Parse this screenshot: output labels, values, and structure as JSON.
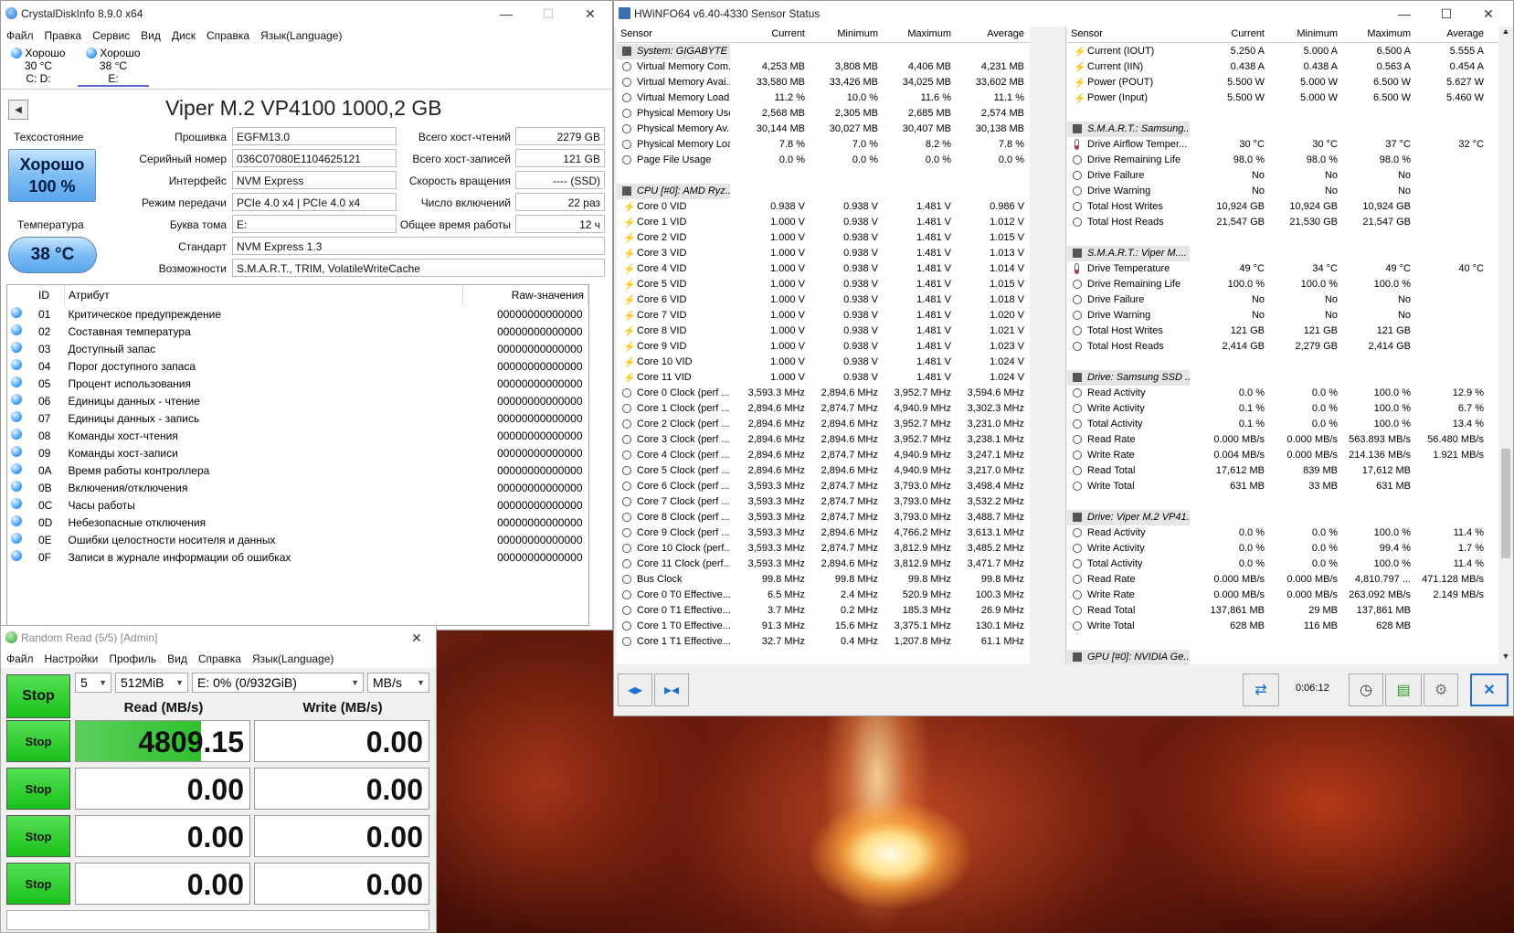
{
  "cdi": {
    "title": "CrystalDiskInfo 8.9.0 x64",
    "menu": [
      "Файл",
      "Правка",
      "Сервис",
      "Вид",
      "Диск",
      "Справка",
      "Язык(Language)"
    ],
    "drives": [
      {
        "status": "Хорошо",
        "temp": "30 °C",
        "letters": "C: D:"
      },
      {
        "status": "Хорошо",
        "temp": "38 °C",
        "letters": "E:"
      }
    ],
    "model": "Viper M.2 VP4100 1000,2 GB",
    "health_label": "Техсостояние",
    "health_status": "Хорошо",
    "health_pct": "100 %",
    "temp_label": "Температура",
    "temp_value": "38 °C",
    "fields": {
      "firmware_label": "Прошивка",
      "firmware": "EGFM13.0",
      "serial_label": "Серийный номер",
      "serial": "036C07080E1104625121",
      "interface_label": "Интерфейс",
      "interface": "NVM Express",
      "transfer_label": "Режим передачи",
      "transfer": "PCIe 4.0 x4 | PCIe 4.0 x4",
      "letter_label": "Буква тома",
      "letter": "E:",
      "standard_label": "Стандарт",
      "standard": "NVM Express 1.3",
      "features_label": "Возможности",
      "features": "S.M.A.R.T., TRIM, VolatileWriteCache",
      "reads_label": "Всего хост-чтений",
      "reads": "2279 GB",
      "writes_label": "Всего хост-записей",
      "writes": "121 GB",
      "rpm_label": "Скорость вращения",
      "rpm": "---- (SSD)",
      "power_count_label": "Число включений",
      "power_count": "22 раз",
      "power_hours_label": "Общее время работы",
      "power_hours": "12 ч"
    },
    "attr_headers": {
      "id": "ID",
      "name": "Атрибут",
      "raw": "Raw-значения"
    },
    "attributes": [
      {
        "id": "01",
        "name": "Критическое предупреждение",
        "raw": "00000000000000"
      },
      {
        "id": "02",
        "name": "Составная температура",
        "raw": "00000000000000"
      },
      {
        "id": "03",
        "name": "Доступный запас",
        "raw": "00000000000000"
      },
      {
        "id": "04",
        "name": "Порог доступного запаса",
        "raw": "00000000000000"
      },
      {
        "id": "05",
        "name": "Процент использования",
        "raw": "00000000000000"
      },
      {
        "id": "06",
        "name": "Единицы данных - чтение",
        "raw": "00000000000000"
      },
      {
        "id": "07",
        "name": "Единицы данных - запись",
        "raw": "00000000000000"
      },
      {
        "id": "08",
        "name": "Команды хост-чтения",
        "raw": "00000000000000"
      },
      {
        "id": "09",
        "name": "Команды хост-записи",
        "raw": "00000000000000"
      },
      {
        "id": "0A",
        "name": "Время работы контроллера",
        "raw": "00000000000000"
      },
      {
        "id": "0B",
        "name": "Включения/отключения",
        "raw": "00000000000000"
      },
      {
        "id": "0C",
        "name": "Часы работы",
        "raw": "00000000000000"
      },
      {
        "id": "0D",
        "name": "Небезопасные отключения",
        "raw": "00000000000000"
      },
      {
        "id": "0E",
        "name": "Ошибки целостности носителя и данных",
        "raw": "00000000000000"
      },
      {
        "id": "0F",
        "name": "Записи в журнале информации об ошибках",
        "raw": "00000000000000"
      }
    ]
  },
  "cdm": {
    "title": "Random Read (5/5) [Admin]",
    "menu": [
      "Файл",
      "Настройки",
      "Профиль",
      "Вид",
      "Справка",
      "Язык(Language)"
    ],
    "count": "5",
    "size": "512MiB",
    "drive": "E: 0% (0/932GiB)",
    "unit": "MB/s",
    "all_label": "Stop",
    "read_header": "Read (MB/s)",
    "write_header": "Write (MB/s)",
    "rows": [
      {
        "btn": "Stop",
        "read": "4809.15",
        "write": "0.00"
      },
      {
        "btn": "Stop",
        "read": "0.00",
        "write": "0.00"
      },
      {
        "btn": "Stop",
        "read": "0.00",
        "write": "0.00"
      },
      {
        "btn": "Stop",
        "read": "0.00",
        "write": "0.00"
      }
    ],
    "read_progress": 0.72
  },
  "hw": {
    "title": "HWiNFO64 v6.40-4330 Sensor Status",
    "headers": {
      "sensor": "Sensor",
      "current": "Current",
      "minimum": "Minimum",
      "maximum": "Maximum",
      "average": "Average"
    },
    "time": "0:06:12",
    "left": [
      {
        "t": "sec",
        "n": "System: GIGABYTE ..."
      },
      {
        "t": "clock",
        "n": "Virtual Memory Com...",
        "v": [
          "4,253 MB",
          "3,808 MB",
          "4,406 MB",
          "4,231 MB"
        ]
      },
      {
        "t": "clock",
        "n": "Virtual Memory Avai...",
        "v": [
          "33,580 MB",
          "33,426 MB",
          "34,025 MB",
          "33,602 MB"
        ]
      },
      {
        "t": "clock",
        "n": "Virtual Memory Load",
        "v": [
          "11.2 %",
          "10.0 %",
          "11.6 %",
          "11.1 %"
        ]
      },
      {
        "t": "clock",
        "n": "Physical Memory Used",
        "v": [
          "2,568 MB",
          "2,305 MB",
          "2,685 MB",
          "2,574 MB"
        ]
      },
      {
        "t": "clock",
        "n": "Physical Memory Av...",
        "v": [
          "30,144 MB",
          "30,027 MB",
          "30,407 MB",
          "30,138 MB"
        ]
      },
      {
        "t": "clock",
        "n": "Physical Memory Load",
        "v": [
          "7.8 %",
          "7.0 %",
          "8.2 %",
          "7.8 %"
        ]
      },
      {
        "t": "clock",
        "n": "Page File Usage",
        "v": [
          "0.0 %",
          "0.0 %",
          "0.0 %",
          "0.0 %"
        ]
      },
      {
        "t": "blank"
      },
      {
        "t": "sec",
        "n": "CPU [#0]: AMD Ryz..."
      },
      {
        "t": "bolt",
        "n": "Core 0 VID",
        "v": [
          "0.938 V",
          "0.938 V",
          "1.481 V",
          "0.986 V"
        ]
      },
      {
        "t": "bolt",
        "n": "Core 1 VID",
        "v": [
          "1.000 V",
          "0.938 V",
          "1.481 V",
          "1.012 V"
        ]
      },
      {
        "t": "bolt",
        "n": "Core 2 VID",
        "v": [
          "1.000 V",
          "0.938 V",
          "1.481 V",
          "1.015 V"
        ]
      },
      {
        "t": "bolt",
        "n": "Core 3 VID",
        "v": [
          "1.000 V",
          "0.938 V",
          "1.481 V",
          "1.013 V"
        ]
      },
      {
        "t": "bolt",
        "n": "Core 4 VID",
        "v": [
          "1.000 V",
          "0.938 V",
          "1.481 V",
          "1.014 V"
        ]
      },
      {
        "t": "bolt",
        "n": "Core 5 VID",
        "v": [
          "1.000 V",
          "0.938 V",
          "1.481 V",
          "1.015 V"
        ]
      },
      {
        "t": "bolt",
        "n": "Core 6 VID",
        "v": [
          "1.000 V",
          "0.938 V",
          "1.481 V",
          "1.018 V"
        ]
      },
      {
        "t": "bolt",
        "n": "Core 7 VID",
        "v": [
          "1.000 V",
          "0.938 V",
          "1.481 V",
          "1.020 V"
        ]
      },
      {
        "t": "bolt",
        "n": "Core 8 VID",
        "v": [
          "1.000 V",
          "0.938 V",
          "1.481 V",
          "1.021 V"
        ]
      },
      {
        "t": "bolt",
        "n": "Core 9 VID",
        "v": [
          "1.000 V",
          "0.938 V",
          "1.481 V",
          "1.023 V"
        ]
      },
      {
        "t": "bolt",
        "n": "Core 10 VID",
        "v": [
          "1.000 V",
          "0.938 V",
          "1.481 V",
          "1.024 V"
        ]
      },
      {
        "t": "bolt",
        "n": "Core 11 VID",
        "v": [
          "1.000 V",
          "0.938 V",
          "1.481 V",
          "1.024 V"
        ]
      },
      {
        "t": "clock",
        "n": "Core 0 Clock (perf ...",
        "v": [
          "3,593.3 MHz",
          "2,894.6 MHz",
          "3,952.7 MHz",
          "3,594.6 MHz"
        ]
      },
      {
        "t": "clock",
        "n": "Core 1 Clock (perf ...",
        "v": [
          "2,894.6 MHz",
          "2,874.7 MHz",
          "4,940.9 MHz",
          "3,302.3 MHz"
        ]
      },
      {
        "t": "clock",
        "n": "Core 2 Clock (perf ...",
        "v": [
          "2,894.6 MHz",
          "2,894.6 MHz",
          "3,952.7 MHz",
          "3,231.0 MHz"
        ]
      },
      {
        "t": "clock",
        "n": "Core 3 Clock (perf ...",
        "v": [
          "2,894.6 MHz",
          "2,894.6 MHz",
          "3,952.7 MHz",
          "3,238.1 MHz"
        ]
      },
      {
        "t": "clock",
        "n": "Core 4 Clock (perf ...",
        "v": [
          "2,894.6 MHz",
          "2,874.7 MHz",
          "4,940.9 MHz",
          "3,247.1 MHz"
        ]
      },
      {
        "t": "clock",
        "n": "Core 5 Clock (perf ...",
        "v": [
          "2,894.6 MHz",
          "2,894.6 MHz",
          "4,940.9 MHz",
          "3,217.0 MHz"
        ]
      },
      {
        "t": "clock",
        "n": "Core 6 Clock (perf ...",
        "v": [
          "3,593.3 MHz",
          "2,874.7 MHz",
          "3,793.0 MHz",
          "3,498.4 MHz"
        ]
      },
      {
        "t": "clock",
        "n": "Core 7 Clock (perf ...",
        "v": [
          "3,593.3 MHz",
          "2,874.7 MHz",
          "3,793.0 MHz",
          "3,532.2 MHz"
        ]
      },
      {
        "t": "clock",
        "n": "Core 8 Clock (perf ...",
        "v": [
          "3,593.3 MHz",
          "2,874.7 MHz",
          "3,793.0 MHz",
          "3,488.7 MHz"
        ]
      },
      {
        "t": "clock",
        "n": "Core 9 Clock (perf ...",
        "v": [
          "3,593.3 MHz",
          "2,894.6 MHz",
          "4,766.2 MHz",
          "3,613.1 MHz"
        ]
      },
      {
        "t": "clock",
        "n": "Core 10 Clock (perf...",
        "v": [
          "3,593.3 MHz",
          "2,874.7 MHz",
          "3,812.9 MHz",
          "3,485.2 MHz"
        ]
      },
      {
        "t": "clock",
        "n": "Core 11 Clock (perf...",
        "v": [
          "3,593.3 MHz",
          "2,894.6 MHz",
          "3,812.9 MHz",
          "3,471.7 MHz"
        ]
      },
      {
        "t": "clock",
        "n": "Bus Clock",
        "v": [
          "99.8 MHz",
          "99.8 MHz",
          "99.8 MHz",
          "99.8 MHz"
        ]
      },
      {
        "t": "clock",
        "n": "Core 0 T0 Effective...",
        "v": [
          "6.5 MHz",
          "2.4 MHz",
          "520.9 MHz",
          "100.3 MHz"
        ]
      },
      {
        "t": "clock",
        "n": "Core 0 T1 Effective...",
        "v": [
          "3.7 MHz",
          "0.2 MHz",
          "185.3 MHz",
          "26.9 MHz"
        ]
      },
      {
        "t": "clock",
        "n": "Core 1 T0 Effective...",
        "v": [
          "91.3 MHz",
          "15.6 MHz",
          "3,375.1 MHz",
          "130.1 MHz"
        ]
      },
      {
        "t": "clock",
        "n": "Core 1 T1 Effective...",
        "v": [
          "32.7 MHz",
          "0.4 MHz",
          "1,207.8 MHz",
          "61.1 MHz"
        ]
      }
    ],
    "right": [
      {
        "t": "bolt",
        "n": "Current (IOUT)",
        "v": [
          "5.250 A",
          "5.000 A",
          "6.500 A",
          "5.555 A"
        ]
      },
      {
        "t": "bolt",
        "n": "Current (IIN)",
        "v": [
          "0.438 A",
          "0.438 A",
          "0.563 A",
          "0.454 A"
        ]
      },
      {
        "t": "bolt",
        "n": "Power (POUT)",
        "v": [
          "5.500 W",
          "5.000 W",
          "6.500 W",
          "5.627 W"
        ]
      },
      {
        "t": "bolt",
        "n": "Power (Input)",
        "v": [
          "5.500 W",
          "5.000 W",
          "6.500 W",
          "5.460 W"
        ]
      },
      {
        "t": "blank"
      },
      {
        "t": "sec",
        "n": "S.M.A.R.T.: Samsung..."
      },
      {
        "t": "therm",
        "n": "Drive Airflow Temper...",
        "v": [
          "30 °C",
          "30 °C",
          "37 °C",
          "32 °C"
        ]
      },
      {
        "t": "clock",
        "n": "Drive Remaining Life",
        "v": [
          "98.0 %",
          "98.0 %",
          "98.0 %",
          ""
        ]
      },
      {
        "t": "clock",
        "n": "Drive Failure",
        "v": [
          "No",
          "No",
          "No",
          ""
        ]
      },
      {
        "t": "clock",
        "n": "Drive Warning",
        "v": [
          "No",
          "No",
          "No",
          ""
        ]
      },
      {
        "t": "clock",
        "n": "Total Host Writes",
        "v": [
          "10,924 GB",
          "10,924 GB",
          "10,924 GB",
          ""
        ]
      },
      {
        "t": "clock",
        "n": "Total Host Reads",
        "v": [
          "21,547 GB",
          "21,530 GB",
          "21,547 GB",
          ""
        ]
      },
      {
        "t": "blank"
      },
      {
        "t": "sec",
        "n": "S.M.A.R.T.: Viper M...."
      },
      {
        "t": "therm",
        "n": "Drive Temperature",
        "v": [
          "49 °C",
          "34 °C",
          "49 °C",
          "40 °C"
        ]
      },
      {
        "t": "clock",
        "n": "Drive Remaining Life",
        "v": [
          "100.0 %",
          "100.0 %",
          "100.0 %",
          ""
        ]
      },
      {
        "t": "clock",
        "n": "Drive Failure",
        "v": [
          "No",
          "No",
          "No",
          ""
        ]
      },
      {
        "t": "clock",
        "n": "Drive Warning",
        "v": [
          "No",
          "No",
          "No",
          ""
        ]
      },
      {
        "t": "clock",
        "n": "Total Host Writes",
        "v": [
          "121 GB",
          "121 GB",
          "121 GB",
          ""
        ]
      },
      {
        "t": "clock",
        "n": "Total Host Reads",
        "v": [
          "2,414 GB",
          "2,279 GB",
          "2,414 GB",
          ""
        ]
      },
      {
        "t": "blank"
      },
      {
        "t": "sec",
        "n": "Drive: Samsung SSD ..."
      },
      {
        "t": "clock",
        "n": "Read Activity",
        "v": [
          "0.0 %",
          "0.0 %",
          "100.0 %",
          "12.9 %"
        ]
      },
      {
        "t": "clock",
        "n": "Write Activity",
        "v": [
          "0.1 %",
          "0.0 %",
          "100.0 %",
          "6.7 %"
        ]
      },
      {
        "t": "clock",
        "n": "Total Activity",
        "v": [
          "0.1 %",
          "0.0 %",
          "100.0 %",
          "13.4 %"
        ]
      },
      {
        "t": "clock",
        "n": "Read Rate",
        "v": [
          "0.000 MB/s",
          "0.000 MB/s",
          "563.893 MB/s",
          "56.480 MB/s"
        ]
      },
      {
        "t": "clock",
        "n": "Write Rate",
        "v": [
          "0.004 MB/s",
          "0.000 MB/s",
          "214.136 MB/s",
          "1.921 MB/s"
        ]
      },
      {
        "t": "clock",
        "n": "Read Total",
        "v": [
          "17,612 MB",
          "839 MB",
          "17,612 MB",
          ""
        ]
      },
      {
        "t": "clock",
        "n": "Write Total",
        "v": [
          "631 MB",
          "33 MB",
          "631 MB",
          ""
        ]
      },
      {
        "t": "blank"
      },
      {
        "t": "sec",
        "n": "Drive: Viper M.2 VP41..."
      },
      {
        "t": "clock",
        "n": "Read Activity",
        "v": [
          "0.0 %",
          "0.0 %",
          "100.0 %",
          "11.4 %"
        ]
      },
      {
        "t": "clock",
        "n": "Write Activity",
        "v": [
          "0.0 %",
          "0.0 %",
          "99.4 %",
          "1.7 %"
        ]
      },
      {
        "t": "clock",
        "n": "Total Activity",
        "v": [
          "0.0 %",
          "0.0 %",
          "100.0 %",
          "11.4 %"
        ]
      },
      {
        "t": "clock",
        "n": "Read Rate",
        "v": [
          "0.000 MB/s",
          "0.000 MB/s",
          "4,810.797 ...",
          "471.128 MB/s"
        ]
      },
      {
        "t": "clock",
        "n": "Write Rate",
        "v": [
          "0.000 MB/s",
          "0.000 MB/s",
          "263.092 MB/s",
          "2.149 MB/s"
        ]
      },
      {
        "t": "clock",
        "n": "Read Total",
        "v": [
          "137,861 MB",
          "29 MB",
          "137,861 MB",
          ""
        ]
      },
      {
        "t": "clock",
        "n": "Write Total",
        "v": [
          "628 MB",
          "116 MB",
          "628 MB",
          ""
        ]
      },
      {
        "t": "blank"
      },
      {
        "t": "sec",
        "n": "GPU [#0]: NVIDIA Ge..."
      }
    ]
  }
}
